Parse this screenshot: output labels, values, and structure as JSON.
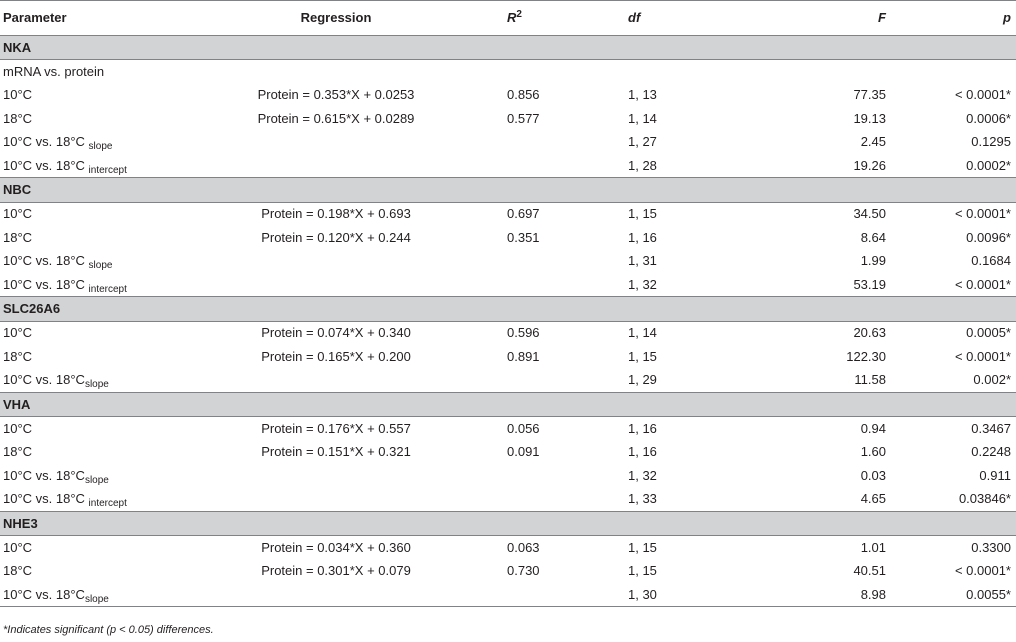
{
  "header": {
    "parameter": "Parameter",
    "regression": "Regression",
    "r2_base": "R",
    "r2_sup": "2",
    "df": "df",
    "f": "F",
    "p": "p"
  },
  "rows": [
    {
      "type": "section",
      "label": "NKA"
    },
    {
      "type": "plain",
      "label": "mRNA vs. protein"
    },
    {
      "type": "data",
      "param": "10°C",
      "reg": "Protein = 0.353*X + 0.0253",
      "r2": "0.856",
      "df": "1, 13",
      "f": "77.35",
      "p": "< 0.0001*"
    },
    {
      "type": "data",
      "param": "18°C",
      "reg": "Protein = 0.615*X + 0.0289",
      "r2": "0.577",
      "df": "1, 14",
      "f": "19.13",
      "p": "0.0006*"
    },
    {
      "type": "data",
      "param": "10°C vs. 18°C ",
      "sub": "slope",
      "df": "1, 27",
      "f": "2.45",
      "p": "0.1295"
    },
    {
      "type": "data",
      "param": "10°C vs. 18°C ",
      "sub": "intercept",
      "df": "1, 28",
      "f": "19.26",
      "p": "0.0002*"
    },
    {
      "type": "section",
      "label": "NBC"
    },
    {
      "type": "data",
      "param": "10°C",
      "reg": "Protein = 0.198*X + 0.693",
      "r2": "0.697",
      "df": "1, 15",
      "f": "34.50",
      "p": "< 0.0001*"
    },
    {
      "type": "data",
      "param": "18°C",
      "reg": "Protein = 0.120*X + 0.244",
      "r2": "0.351",
      "df": "1, 16",
      "f": "8.64",
      "p": "0.0096*"
    },
    {
      "type": "data",
      "param": "10°C vs. 18°C ",
      "sub": "slope",
      "df": "1, 31",
      "f": "1.99",
      "p": "0.1684"
    },
    {
      "type": "data",
      "param": "10°C vs. 18°C ",
      "sub": "intercept",
      "df": "1, 32",
      "f": "53.19",
      "p": "< 0.0001*"
    },
    {
      "type": "section",
      "label": "SLC26A6"
    },
    {
      "type": "data",
      "param": "10°C",
      "reg": "Protein = 0.074*X + 0.340",
      "r2": "0.596",
      "df": "1, 14",
      "f": "20.63",
      "p": "0.0005*"
    },
    {
      "type": "data",
      "param": "18°C",
      "reg": "Protein = 0.165*X + 0.200",
      "r2": "0.891",
      "df": "1, 15",
      "f": "122.30",
      "p": "< 0.0001*"
    },
    {
      "type": "data",
      "param": "10°C vs. 18°C",
      "sub": "slope",
      "df": "1, 29",
      "f": "11.58",
      "p": "0.002*"
    },
    {
      "type": "section",
      "label": "VHA"
    },
    {
      "type": "data",
      "param": "10°C",
      "reg": "Protein = 0.176*X + 0.557",
      "r2": "0.056",
      "df": "1, 16",
      "f": "0.94",
      "p": "0.3467"
    },
    {
      "type": "data",
      "param": "18°C",
      "reg": "Protein = 0.151*X + 0.321",
      "r2": "0.091",
      "df": "1, 16",
      "f": "1.60",
      "p": "0.2248"
    },
    {
      "type": "data",
      "param": "10°C vs. 18°C",
      "sub": "slope",
      "df": "1, 32",
      "f": "0.03",
      "p": "0.911"
    },
    {
      "type": "data",
      "param": "10°C vs. 18°C ",
      "sub": "intercept",
      "df": "1, 33",
      "f": "4.65",
      "p": "0.03846*"
    },
    {
      "type": "section",
      "label": "NHE3"
    },
    {
      "type": "data",
      "param": "10°C",
      "reg": "Protein = 0.034*X + 0.360",
      "r2": "0.063",
      "df": "1, 15",
      "f": "1.01",
      "p": "0.3300"
    },
    {
      "type": "data",
      "param": "18°C",
      "reg": "Protein = 0.301*X + 0.079",
      "r2": "0.730",
      "df": "1, 15",
      "f": "40.51",
      "p": "< 0.0001*"
    },
    {
      "type": "data",
      "param": "10°C vs. 18°C",
      "sub": "slope",
      "df": "1, 30",
      "f": "8.98",
      "p": "0.0055*"
    }
  ],
  "footnote": "*Indicates significant (p < 0.05) differences."
}
